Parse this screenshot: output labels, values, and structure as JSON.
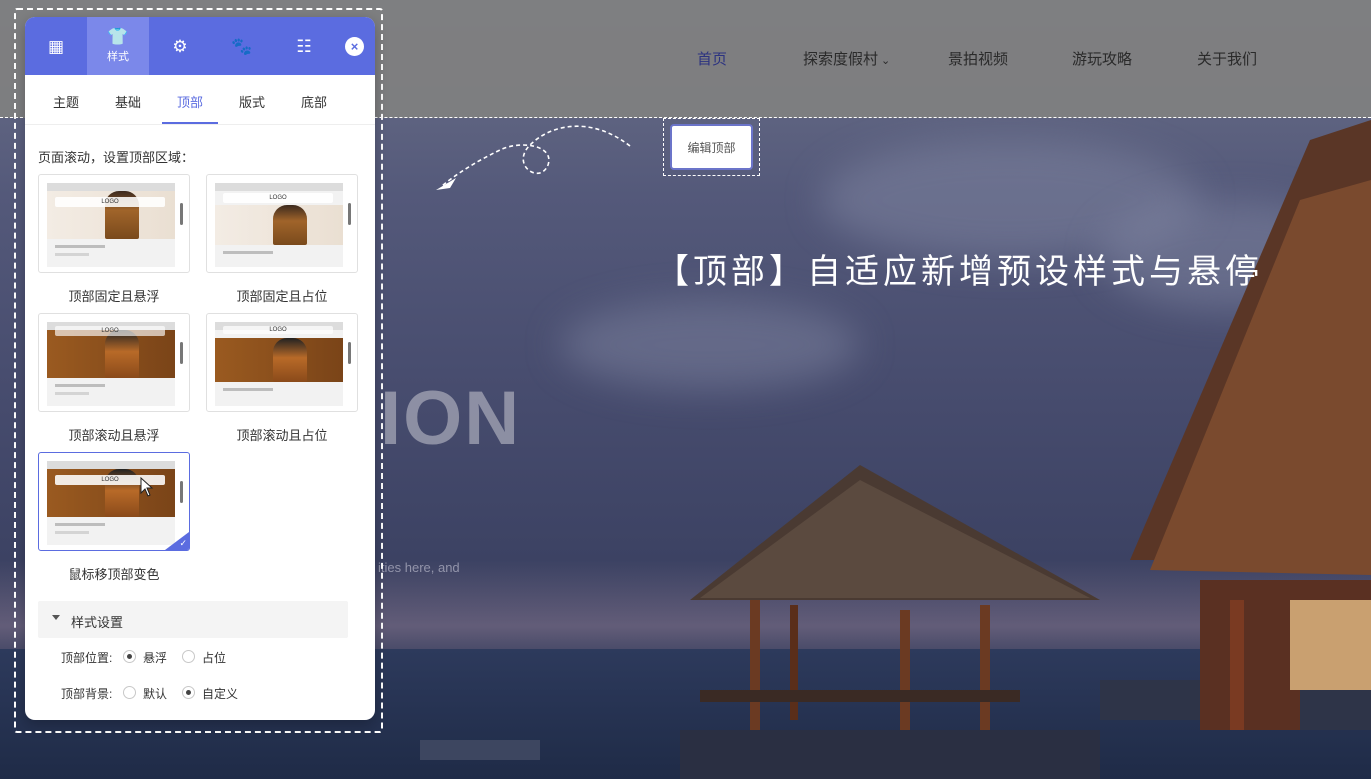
{
  "nav": {
    "items": [
      {
        "label": "首页",
        "active": true
      },
      {
        "label": "探索度假村",
        "has_dropdown": true
      },
      {
        "label": "景拍视频"
      },
      {
        "label": "游玩攻略"
      },
      {
        "label": "关于我们"
      }
    ],
    "dropdown_icon": "chevron-down-icon"
  },
  "edit_top_button": "编辑顶部",
  "headline": "【顶部】自适应新增预设样式与悬停",
  "hero": {
    "big_word": "ION",
    "subtext": "ities here, and"
  },
  "panel": {
    "head_buttons": [
      {
        "icon": "grid-icon",
        "glyph": "▦",
        "label": ""
      },
      {
        "icon": "shirt-icon",
        "glyph": "👕",
        "label": "样式",
        "active": true
      },
      {
        "icon": "gear-icon",
        "glyph": "⚙",
        "label": ""
      },
      {
        "icon": "paw-icon",
        "glyph": "🐾",
        "label": ""
      },
      {
        "icon": "list-icon",
        "glyph": "☷",
        "label": ""
      }
    ],
    "close_glyph": "×",
    "tabs": [
      {
        "label": "主题"
      },
      {
        "label": "基础"
      },
      {
        "label": "顶部",
        "active": true
      },
      {
        "label": "版式"
      },
      {
        "label": "底部"
      }
    ],
    "section_label": "页面滚动，设置顶部区域：",
    "presets": [
      {
        "caption": "顶部固定且悬浮",
        "theme": "light"
      },
      {
        "caption": "顶部固定且占位",
        "theme": "light"
      },
      {
        "caption": "顶部滚动且悬浮",
        "theme": "dark"
      },
      {
        "caption": "顶部滚动且占位",
        "theme": "dark"
      },
      {
        "caption": "鼠标移顶部变色",
        "theme": "dark",
        "selected": true
      }
    ],
    "thumb_logo": "LOGO",
    "style_settings": {
      "label": "样式设置",
      "position": {
        "label": "顶部位置:",
        "options": [
          {
            "label": "悬浮",
            "checked": true
          },
          {
            "label": "占位",
            "checked": false
          }
        ]
      },
      "background": {
        "label": "顶部背景:",
        "options": [
          {
            "label": "默认",
            "checked": false
          },
          {
            "label": "自定义",
            "checked": true
          }
        ]
      }
    }
  },
  "colors": {
    "accent": "#5b6ce0",
    "topbar": "#808080",
    "nav_active": "#2c3380"
  }
}
